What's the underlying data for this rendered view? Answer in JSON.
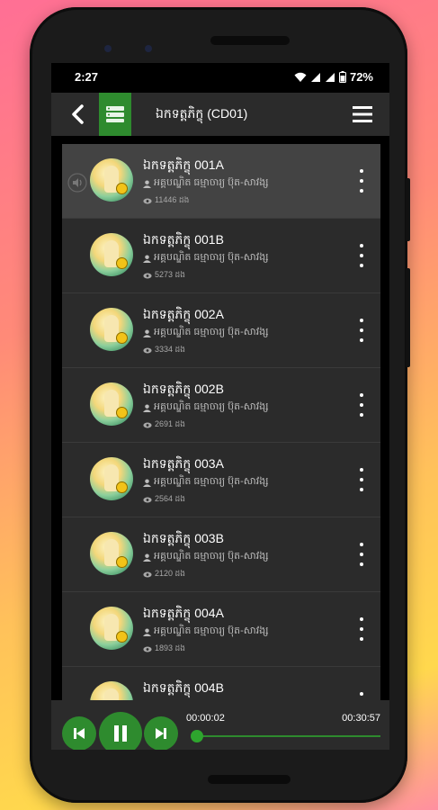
{
  "status_bar": {
    "time": "2:27",
    "battery": "72%"
  },
  "app_bar": {
    "title": "ឯកទត្តភិក្ខុ (CD01)"
  },
  "tracks": [
    {
      "title": "ឯកទត្តភិក្ខុ 001A",
      "artist": "អគ្គបណ្ឌិត ធម្មាចារ្យ ប៊ុត-សាវង្ស",
      "views": "11446 ដង",
      "active": true
    },
    {
      "title": "ឯកទត្តភិក្ខុ 001B",
      "artist": "អគ្គបណ្ឌិត ធម្មាចារ្យ ប៊ុត-សាវង្ស",
      "views": "5273 ដង",
      "active": false
    },
    {
      "title": "ឯកទត្តភិក្ខុ 002A",
      "artist": "អគ្គបណ្ឌិត ធម្មាចារ្យ ប៊ុត-សាវង្ស",
      "views": "3334 ដង",
      "active": false
    },
    {
      "title": "ឯកទត្តភិក្ខុ 002B",
      "artist": "អគ្គបណ្ឌិត ធម្មាចារ្យ ប៊ុត-សាវង្ស",
      "views": "2691 ដង",
      "active": false
    },
    {
      "title": "ឯកទត្តភិក្ខុ 003A",
      "artist": "អគ្គបណ្ឌិត ធម្មាចារ្យ ប៊ុត-សាវង្ស",
      "views": "2564 ដង",
      "active": false
    },
    {
      "title": "ឯកទត្តភិក្ខុ 003B",
      "artist": "អគ្គបណ្ឌិត ធម្មាចារ្យ ប៊ុត-សាវង្ស",
      "views": "2120 ដង",
      "active": false
    },
    {
      "title": "ឯកទត្តភិក្ខុ 004A",
      "artist": "អគ្គបណ្ឌិត ធម្មាចារ្យ ប៊ុត-សាវង្ស",
      "views": "1893 ដង",
      "active": false
    },
    {
      "title": "ឯកទត្តភិក្ខុ 004B",
      "artist": "",
      "views": "",
      "active": false
    }
  ],
  "player": {
    "current_time": "00:00:02",
    "total_time": "00:30:57",
    "progress_fraction": 0.01
  },
  "colors": {
    "accent": "#2e8b2e",
    "surface": "#2b2b2b",
    "active_row": "#434343"
  }
}
